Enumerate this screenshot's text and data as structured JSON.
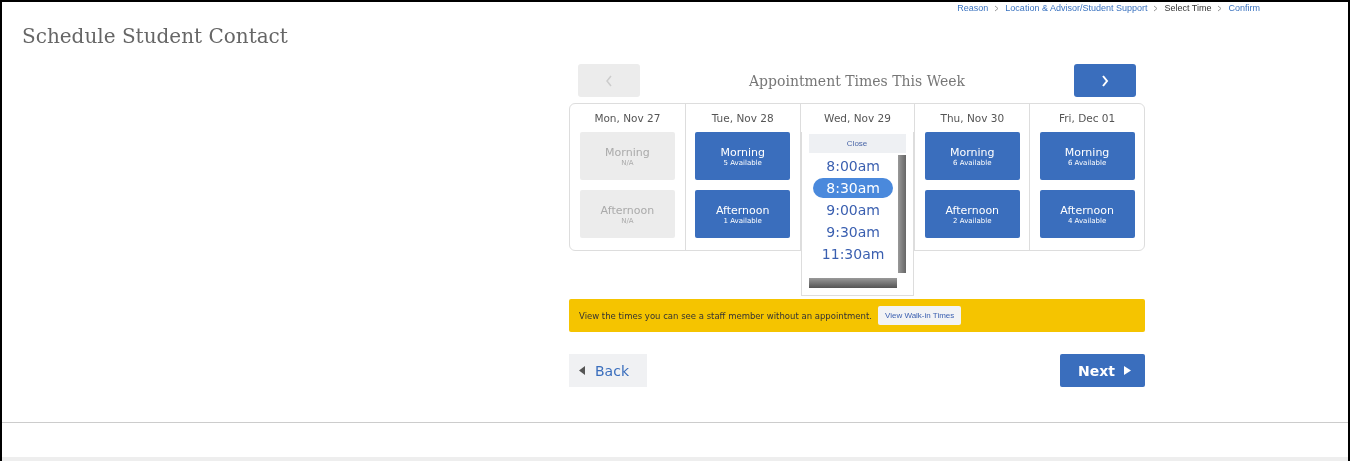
{
  "breadcrumb": [
    {
      "label": "Reason",
      "current": false
    },
    {
      "label": "Location & Advisor/Student Support",
      "current": false
    },
    {
      "label": "Select Time",
      "current": true
    },
    {
      "label": "Confirm",
      "current": false
    }
  ],
  "page_title": "Schedule Student Contact",
  "week_nav": {
    "title": "Appointment Times This Week",
    "prev_disabled": true,
    "next_disabled": false
  },
  "days": [
    {
      "date": "Mon, Nov 27",
      "slots": [
        {
          "kind": "na",
          "label": "Morning",
          "detail": "N/A"
        },
        {
          "kind": "na",
          "label": "Afternoon",
          "detail": "N/A"
        }
      ]
    },
    {
      "date": "Tue, Nov 28",
      "slots": [
        {
          "kind": "available",
          "label": "Morning",
          "detail": "5 Available"
        },
        {
          "kind": "available",
          "label": "Afternoon",
          "detail": "1 Available"
        }
      ]
    },
    {
      "date": "Wed, Nov 29",
      "expanded": true,
      "close_label": "Close",
      "times": [
        {
          "label": "8:00am",
          "selected": false
        },
        {
          "label": "8:30am",
          "selected": true
        },
        {
          "label": "9:00am",
          "selected": false
        },
        {
          "label": "9:30am",
          "selected": false
        },
        {
          "label": "11:30am",
          "selected": false
        }
      ]
    },
    {
      "date": "Thu, Nov 30",
      "slots": [
        {
          "kind": "available",
          "label": "Morning",
          "detail": "6 Available"
        },
        {
          "kind": "available",
          "label": "Afternoon",
          "detail": "2 Available"
        }
      ]
    },
    {
      "date": "Fri, Dec 01",
      "slots": [
        {
          "kind": "available",
          "label": "Morning",
          "detail": "6 Available"
        },
        {
          "kind": "available",
          "label": "Afternoon",
          "detail": "4 Available"
        }
      ]
    }
  ],
  "walk_in": {
    "text": "View the times you can see a staff member without an appointment.",
    "button": "View Walk-in Times"
  },
  "buttons": {
    "back": "Back",
    "next": "Next"
  }
}
